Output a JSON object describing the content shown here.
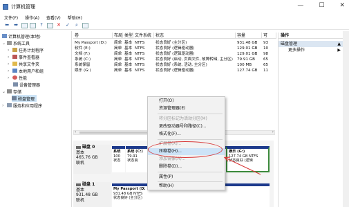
{
  "window": {
    "title": "计算机管理",
    "minimize": "—",
    "maximize": "☐",
    "close": "✕"
  },
  "menu": [
    "文件(F)",
    "操作(A)",
    "查看(V)",
    "帮助(H)"
  ],
  "toolbar_icons": [
    "back-arrow-icon",
    "forward-arrow-icon",
    "folder-icon",
    "properties-icon",
    "help-icon",
    "disk-icon",
    "delete-icon",
    "check-icon",
    "search-icon",
    "properties-list-icon"
  ],
  "tree": {
    "root": "计算机管理(本地)",
    "system_tools": "系统工具",
    "task_scheduler": "任务计划程序",
    "event_viewer": "事件查看器",
    "shared_folders": "共享文件夹",
    "local_users": "本地用户和组",
    "performance": "性能",
    "device_manager": "设备管理器",
    "storage": "存储",
    "disk_management": "磁盘管理",
    "services": "服务和应用程序"
  },
  "volume_table": {
    "headers": [
      "卷",
      "布局",
      "类型",
      "文件系统",
      "状态",
      "容量",
      "可"
    ],
    "rows": [
      [
        "My Passport (D:)",
        "简单",
        "基本",
        "NTFS",
        "状态良好 (主分区)",
        "931.48 GB",
        "93"
      ],
      [
        "软件 (E:)",
        "简单",
        "基本",
        "NTFS",
        "状态良好 (逻辑驱动器)",
        "129.01 GB",
        "10"
      ],
      [
        "文档 (F:)",
        "简单",
        "基本",
        "NTFS",
        "状态良好 (逻辑驱动器)",
        "129.01 GB",
        "98"
      ],
      [
        "系统 (C:)",
        "简单",
        "基本",
        "NTFS",
        "状态良好 (启动, 页面文件, 故障转储, 主分区)",
        "79.91 GB",
        "65"
      ],
      [
        "系统保留",
        "简单",
        "基本",
        "NTFS",
        "状态良好 (系统, 活动, 主分区)",
        "100 MB",
        "65"
      ],
      [
        "娱乐 (G:)",
        "简单",
        "基本",
        "NTFS",
        "状态良好 (逻辑驱动器)",
        "127.74 GB",
        "11"
      ]
    ]
  },
  "operations": {
    "header": "操作",
    "section": "磁盘管理",
    "section_arrow": "▲",
    "more": "更多操作",
    "more_arrow": "▶"
  },
  "context_menu": {
    "items": [
      {
        "label": "打开(O)",
        "disabled": false
      },
      {
        "label": "资源管理器(E)",
        "disabled": false
      },
      {
        "label": "将分区标记为活动分区(M)",
        "disabled": true
      },
      {
        "label": "更改驱动器号和路径(C)...",
        "disabled": false
      },
      {
        "label": "格式化(F)...",
        "disabled": false
      },
      {
        "label": "扩展卷(X)...",
        "disabled": true
      },
      {
        "label": "压缩卷(H)...",
        "disabled": false,
        "highlight": true
      },
      {
        "label": "添加镜像(A)...",
        "disabled": true
      },
      {
        "label": "删除卷(D)...",
        "disabled": false
      },
      {
        "label": "属性(P)",
        "disabled": false
      },
      {
        "label": "帮助(H)",
        "disabled": false
      }
    ]
  },
  "disks": [
    {
      "name": "磁盘 0",
      "type": "基本",
      "size": "465.76 GB",
      "status": "联机",
      "partitions": [
        {
          "name": "系统",
          "size": "100",
          "status": "状态"
        },
        {
          "name": "系统 (C:)",
          "size": "79.91",
          "status": "状态良"
        },
        {
          "name": "娱乐 (G:)",
          "size": "127.74 GB NTFS",
          "status": "状态良好 (逻辑"
        }
      ]
    },
    {
      "name": "磁盘 1",
      "type": "基本",
      "size": "931.48 GB",
      "status": "联机",
      "partitions": [
        {
          "name": "My Passport (D:",
          "size": "931.48 GB NTFS",
          "status": "状态良好 (主分区)"
        }
      ]
    }
  ],
  "colors": {
    "partition_header": "#1d3a8c",
    "selected_partition_border": "#3c8a3c",
    "annotation": "#d83b3b",
    "menu_highlight": "#cde3f7",
    "ops_section_bg": "#dbe6f2"
  }
}
